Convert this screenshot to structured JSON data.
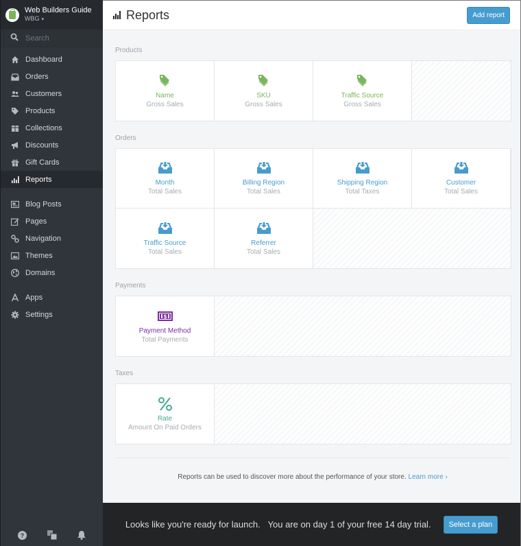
{
  "shop": {
    "name": "Web Builders Guide",
    "code": "WBG",
    "caret": "▾"
  },
  "search": {
    "placeholder": "Search"
  },
  "sidebar": {
    "groups": [
      [
        {
          "label": "Dashboard",
          "icon": "home-icon"
        },
        {
          "label": "Orders",
          "icon": "inbox-icon"
        },
        {
          "label": "Customers",
          "icon": "users-icon"
        },
        {
          "label": "Products",
          "icon": "tag-icon"
        },
        {
          "label": "Collections",
          "icon": "box-icon"
        },
        {
          "label": "Discounts",
          "icon": "megaphone-icon"
        },
        {
          "label": "Gift Cards",
          "icon": "gift-icon"
        },
        {
          "label": "Reports",
          "icon": "bar-chart-icon",
          "active": true
        }
      ],
      [
        {
          "label": "Blog Posts",
          "icon": "blog-icon"
        },
        {
          "label": "Pages",
          "icon": "edit-icon"
        },
        {
          "label": "Navigation",
          "icon": "link-icon"
        },
        {
          "label": "Themes",
          "icon": "image-icon"
        },
        {
          "label": "Domains",
          "icon": "globe-icon"
        }
      ],
      [
        {
          "label": "Apps",
          "icon": "apps-icon"
        },
        {
          "label": "Settings",
          "icon": "gear-icon"
        }
      ]
    ],
    "footer": [
      "help-icon",
      "windows-icon",
      "bell-icon"
    ]
  },
  "header": {
    "title": "Reports",
    "add_button": "Add report"
  },
  "sections": [
    {
      "label": "Products",
      "color": "#7ab55c",
      "icon": "tag-icon",
      "cards": [
        {
          "name": "Name",
          "metric": "Gross Sales"
        },
        {
          "name": "SKU",
          "metric": "Gross Sales"
        },
        {
          "name": "Traffic Source",
          "metric": "Gross Sales"
        }
      ]
    },
    {
      "label": "Orders",
      "color": "#479ccf",
      "icon": "inbox-icon",
      "cards": [
        {
          "name": "Month",
          "metric": "Total Sales"
        },
        {
          "name": "Billing Region",
          "metric": "Total Sales"
        },
        {
          "name": "Shipping Region",
          "metric": "Total Taxes"
        },
        {
          "name": "Customer",
          "metric": "Total Sales"
        },
        {
          "name": "Traffic Source",
          "metric": "Total Sales"
        },
        {
          "name": "Referrer",
          "metric": "Total Sales"
        }
      ]
    },
    {
      "label": "Payments",
      "color": "#7b2ba3",
      "icon": "money-icon",
      "cards": [
        {
          "name": "Payment Method",
          "metric": "Total Payments"
        }
      ]
    },
    {
      "label": "Taxes",
      "color": "#47a890",
      "icon": "percent-icon",
      "cards": [
        {
          "name": "Rate",
          "metric": "Amount On Paid Orders"
        }
      ]
    }
  ],
  "info": {
    "text": "Reports can be used to discover more about the performance of your store.",
    "link": "Learn more ›"
  },
  "launch": {
    "message1": "Looks like you're ready for launch.",
    "message2": "You are on day 1 of your free 14 day trial.",
    "button": "Select a plan"
  },
  "colors": {
    "accent": "#479ccf",
    "sidebar": "#30353b",
    "products": "#7ab55c",
    "orders": "#479ccf",
    "payments": "#7b2ba3",
    "taxes": "#47a890"
  }
}
